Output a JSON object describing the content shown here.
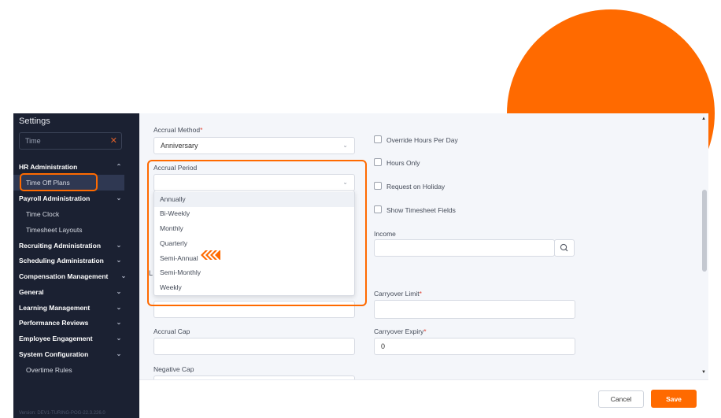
{
  "sidebar": {
    "title": "Settings",
    "search": {
      "value": "Time",
      "clear_icon": "close-icon"
    },
    "sections": [
      {
        "label": "HR Administration",
        "expanded": true,
        "items": [
          "Time Off Plans"
        ]
      },
      {
        "label": "Payroll Administration",
        "expanded": true,
        "items": [
          "Time Clock",
          "Timesheet Layouts"
        ]
      },
      {
        "label": "Recruiting Administration",
        "expanded": false
      },
      {
        "label": "Scheduling Administration",
        "expanded": false
      },
      {
        "label": "Compensation Management",
        "expanded": false
      },
      {
        "label": "General",
        "expanded": false
      },
      {
        "label": "Learning Management",
        "expanded": false
      },
      {
        "label": "Performance Reviews",
        "expanded": false
      },
      {
        "label": "Employee Engagement",
        "expanded": false
      },
      {
        "label": "System Configuration",
        "expanded": true,
        "items": [
          "Overtime Rules"
        ]
      }
    ],
    "active_item": "Time Off Plans",
    "version": "Version: DEV1-TURING-POG-22.3.226.0"
  },
  "form": {
    "accrual_method": {
      "label": "Accrual Method",
      "required": "*",
      "value": "Anniversary"
    },
    "accrual_period": {
      "label": "Accrual Period",
      "value": "",
      "options": [
        "Annually",
        "Bi-Weekly",
        "Monthly",
        "Quarterly",
        "Semi-Annual",
        "Semi-Monthly",
        "Weekly"
      ],
      "hovered": "Annually",
      "highlighted": "Semi-Annual"
    },
    "partial_label": "L",
    "accrual_cap": {
      "label": "Accrual Cap",
      "value": ""
    },
    "negative_cap": {
      "label": "Negative Cap",
      "value": ""
    },
    "checkboxes": [
      {
        "label": "Override Hours Per Day",
        "checked": false
      },
      {
        "label": "Hours Only",
        "checked": false
      },
      {
        "label": "Request on Holiday",
        "checked": false
      },
      {
        "label": "Show Timesheet Fields",
        "checked": false
      }
    ],
    "income": {
      "label": "Income",
      "value": "",
      "search_icon": "search-icon"
    },
    "carryover_limit": {
      "label": "Carryover Limit",
      "required": "*",
      "value": ""
    },
    "carryover_expiry": {
      "label": "Carryover Expiry",
      "required": "*",
      "value": "0"
    }
  },
  "footer": {
    "cancel_label": "Cancel",
    "save_label": "Save"
  },
  "colors": {
    "accent": "#ff6a00",
    "sidebar_bg": "#1b2132",
    "required": "#e0483a"
  }
}
